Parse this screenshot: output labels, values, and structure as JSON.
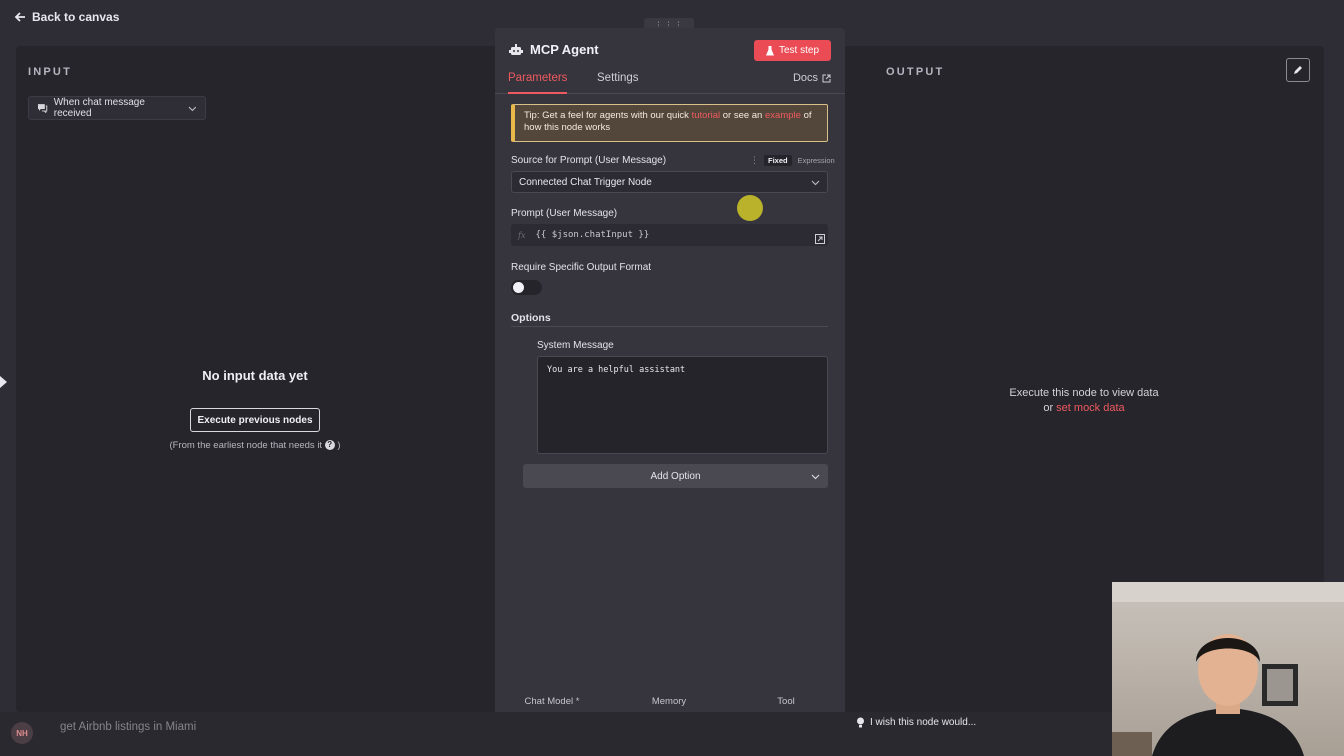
{
  "topbar": {
    "back_label": "Back to canvas"
  },
  "input_panel": {
    "title": "INPUT",
    "trigger_select": "When chat message received",
    "empty_title": "No input data yet",
    "execute_button": "Execute previous nodes",
    "note": "(From the earliest node that needs it",
    "note_close": ")"
  },
  "output_panel": {
    "title": "OUTPUT",
    "message_line1": "Execute this node to view data",
    "message_or": "or",
    "mock_link": "set mock data"
  },
  "node": {
    "title": "MCP Agent",
    "test_step": "Test step",
    "tabs": [
      {
        "label": "Parameters",
        "active": true
      },
      {
        "label": "Settings",
        "active": false
      }
    ],
    "docs": "Docs",
    "tip": {
      "prefix": "Tip: Get a feel for agents with our quick",
      "link1": "tutorial",
      "middle": "or see an",
      "link2": "example",
      "suffix": "of how this node works"
    },
    "source_label": "Source for Prompt (User Message)",
    "mode_fixed": "Fixed",
    "mode_expression": "Expression",
    "source_value": "Connected Chat Trigger Node",
    "prompt_label": "Prompt (User Message)",
    "prompt_fx": "fx",
    "prompt_value": "{{ $json.chatInput }}",
    "output_format_label": "Require Specific Output Format",
    "output_format_enabled": false,
    "options_title": "Options",
    "system_message_label": "System Message",
    "system_message_value": "You are a helpful assistant",
    "add_option": "Add Option",
    "sub_nodes": {
      "chat_model": "Chat Model *",
      "memory": "Memory",
      "tool": "Tool"
    }
  },
  "bottom": {
    "avatar_initials": "NH",
    "chat_placeholder": "get Airbnb listings in Miami",
    "wish_text": "I wish this node would..."
  },
  "colors": {
    "accent": "#ea4b55",
    "panel_bg": "#26252c",
    "node_bg": "#36353d",
    "tip_border": "#e8b84a"
  },
  "icons": [
    "arrow-left-icon",
    "chat-icon",
    "chevron-down-icon",
    "robot-icon",
    "flask-icon",
    "external-link-icon",
    "expand-icon",
    "pencil-icon",
    "help-icon",
    "openai-icon",
    "plus-icon",
    "lightbulb-icon"
  ]
}
